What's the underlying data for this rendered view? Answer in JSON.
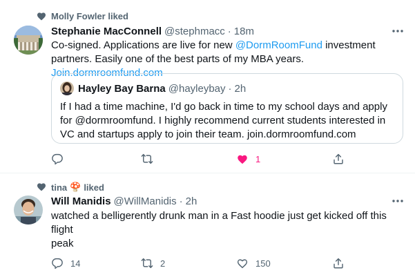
{
  "tweets": [
    {
      "social_context": "Molly Fowler liked",
      "author_name": "Stephanie MacConnell",
      "author_handle": "@stephmacc",
      "separator": "·",
      "time": "18m",
      "text": {
        "part1": "Co-signed. Applications are live for new ",
        "mention": "@DormRoomFund",
        "part2": " investment partners. Easily one of the best parts of my MBA years. ",
        "link": "Join.dormroomfund.com"
      },
      "quote": {
        "author_name": "Hayley Bay Barna",
        "author_handle": "@hayleybay",
        "separator": "·",
        "time": "2h",
        "text": "If I had a time machine, I'd go back in time to my school days and apply for @dormroomfund. I highly recommend current students interested in VC and startups apply to join their team. join.dormroomfund.com"
      },
      "actions": {
        "reply": "",
        "retweet": "",
        "like": "1",
        "liked": true
      }
    },
    {
      "social_context_name": "tina",
      "social_context_emoji": "🍄",
      "social_context_suffix": "liked",
      "author_name": "Will Manidis",
      "author_handle": "@WillManidis",
      "separator": "·",
      "time": "2h",
      "text_line1": "watched a belligerently drunk man in a Fast hoodie just get kicked off this flight",
      "text_line2": "peak",
      "actions": {
        "reply": "14",
        "retweet": "2",
        "like": "150",
        "liked": false
      }
    }
  ],
  "colors": {
    "accent": "#1d9bf0",
    "like": "#f91880",
    "muted": "#536471",
    "text": "#0f1419"
  },
  "icons": {
    "social": "heart-filled-icon",
    "more": "more-dots-icon",
    "reply": "reply-icon",
    "retweet": "retweet-icon",
    "like": "heart-icon",
    "share": "share-icon"
  }
}
